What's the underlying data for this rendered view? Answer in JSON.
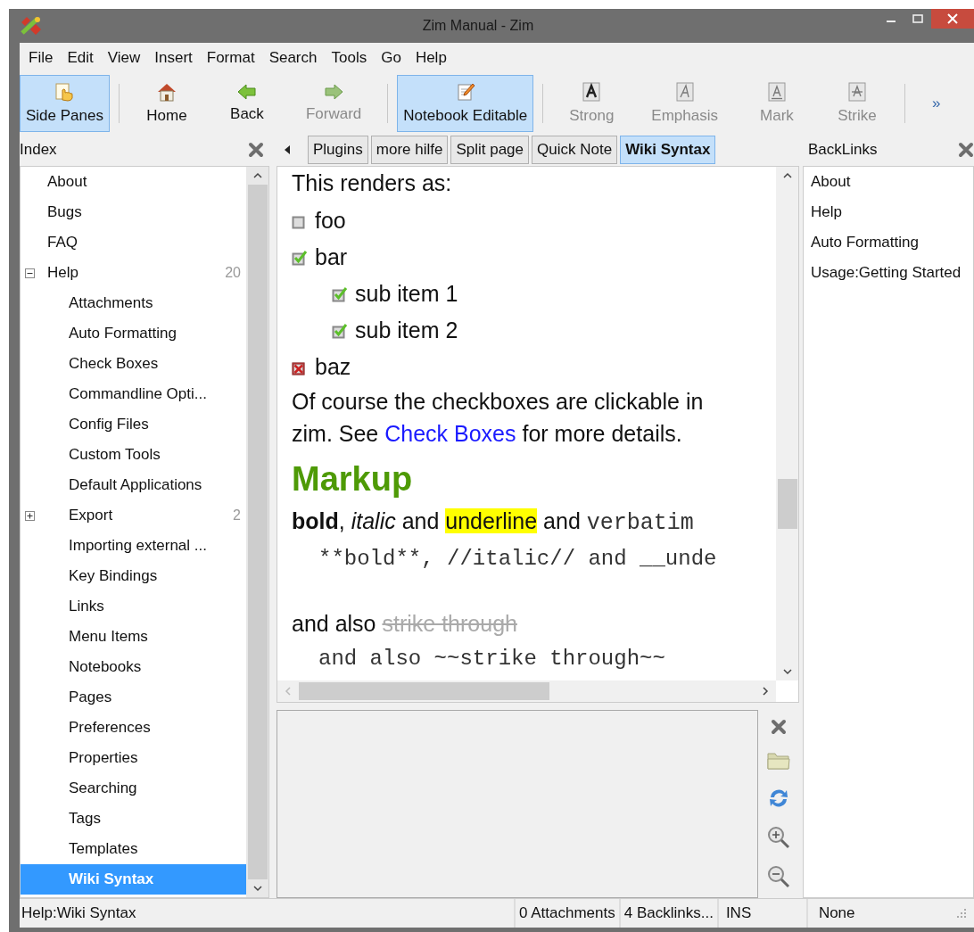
{
  "window": {
    "title": "Zim Manual - Zim"
  },
  "menu": [
    "File",
    "Edit",
    "View",
    "Insert",
    "Format",
    "Search",
    "Tools",
    "Go",
    "Help"
  ],
  "toolbar": [
    {
      "kind": "button",
      "label": "Side Panes",
      "selected": true,
      "disabled": false
    },
    {
      "kind": "separator"
    },
    {
      "kind": "button",
      "label": "Home",
      "selected": false,
      "disabled": false
    },
    {
      "kind": "button",
      "label": "Back",
      "selected": false,
      "disabled": false
    },
    {
      "kind": "button",
      "label": "Forward",
      "selected": false,
      "disabled": true
    },
    {
      "kind": "separator"
    },
    {
      "kind": "button",
      "label": "Notebook Editable",
      "selected": true,
      "disabled": false
    },
    {
      "kind": "separator"
    },
    {
      "kind": "button",
      "label": "Strong",
      "selected": false,
      "disabled": true
    },
    {
      "kind": "button",
      "label": "Emphasis",
      "selected": false,
      "disabled": true
    },
    {
      "kind": "button",
      "label": "Mark",
      "selected": false,
      "disabled": true
    },
    {
      "kind": "button",
      "label": "Strike",
      "selected": false,
      "disabled": true
    },
    {
      "kind": "separator"
    },
    {
      "kind": "overflow",
      "label": "»"
    }
  ],
  "index": {
    "title": "Index",
    "items": [
      {
        "label": "About",
        "selected": false
      },
      {
        "label": "Bugs",
        "selected": false
      },
      {
        "label": "FAQ",
        "selected": false
      },
      {
        "label": "Help",
        "count": "20",
        "expanded": true,
        "selected": false,
        "children": [
          {
            "label": "Attachments",
            "selected": false
          },
          {
            "label": "Auto Formatting",
            "selected": false
          },
          {
            "label": "Check Boxes",
            "selected": false
          },
          {
            "label": "Commandline Opti...",
            "selected": false
          },
          {
            "label": "Config Files",
            "selected": false
          },
          {
            "label": "Custom Tools",
            "selected": false
          },
          {
            "label": "Default Applications",
            "selected": false
          },
          {
            "label": "Export",
            "count": "2",
            "expanded": false,
            "selected": false
          },
          {
            "label": "Importing external ...",
            "selected": false
          },
          {
            "label": "Key Bindings",
            "selected": false
          },
          {
            "label": "Links",
            "selected": false
          },
          {
            "label": "Menu Items",
            "selected": false
          },
          {
            "label": "Notebooks",
            "selected": false
          },
          {
            "label": "Pages",
            "selected": false
          },
          {
            "label": "Preferences",
            "selected": false
          },
          {
            "label": "Properties",
            "selected": false
          },
          {
            "label": "Searching",
            "selected": false
          },
          {
            "label": "Tags",
            "selected": false
          },
          {
            "label": "Templates",
            "selected": false
          },
          {
            "label": "Wiki Syntax",
            "selected": true
          }
        ]
      }
    ]
  },
  "pathbar": [
    {
      "label": "Plugins",
      "selected": false
    },
    {
      "label": "more hilfe",
      "selected": false
    },
    {
      "label": "Split page",
      "selected": false
    },
    {
      "label": "Quick Note",
      "selected": false
    },
    {
      "label": "Wiki Syntax",
      "selected": true
    }
  ],
  "editor": {
    "blocks": [
      {
        "kind": "paragraph",
        "segments": [
          {
            "kind": "plain",
            "text": "This renders as:"
          }
        ]
      },
      {
        "kind": "checkbox",
        "checked": false,
        "crossed": false,
        "text": "foo"
      },
      {
        "kind": "checkbox",
        "checked": true,
        "crossed": false,
        "text": "bar",
        "children": [
          {
            "checked": true,
            "crossed": false,
            "text": "sub item 1"
          },
          {
            "checked": true,
            "crossed": false,
            "text": "sub item 2"
          }
        ]
      },
      {
        "kind": "checkbox",
        "checked": false,
        "crossed": true,
        "text": "baz"
      },
      {
        "kind": "paragraph",
        "segments": [
          {
            "kind": "plain",
            "text": "Of course the checkboxes are clickable in zim. See "
          },
          {
            "kind": "link",
            "text": "Check Boxes"
          },
          {
            "kind": "plain",
            "text": " for more details."
          }
        ]
      },
      {
        "kind": "heading",
        "text": "Markup"
      },
      {
        "kind": "paragraph",
        "segments": [
          {
            "kind": "plain",
            "text": "**bold**, *italic* and "
          },
          {
            "kind": "highlight",
            "text": "underline"
          },
          {
            "kind": "plain",
            "text": " and "
          },
          {
            "kind": "code",
            "text": "verbatim"
          }
        ]
      },
      {
        "kind": "verbatim",
        "text": "**bold**, //italic// and __unde"
      },
      {
        "kind": "spacer"
      },
      {
        "kind": "paragraph",
        "segments": [
          {
            "kind": "plain",
            "text": "and also "
          },
          {
            "kind": "strike",
            "text": "strike through"
          }
        ]
      },
      {
        "kind": "verbatim",
        "text": "and also ~~strike through~~"
      }
    ]
  },
  "backlinks": {
    "title": "BackLinks",
    "items": [
      "About",
      "Help",
      "Auto Formatting",
      "Usage:Getting Started"
    ]
  },
  "status_bar": {
    "page": "Help:Wiki Syntax",
    "attachments": "0 Attachments",
    "backlinks": "4 Backlinks...",
    "mode": "INS",
    "style": "None"
  }
}
